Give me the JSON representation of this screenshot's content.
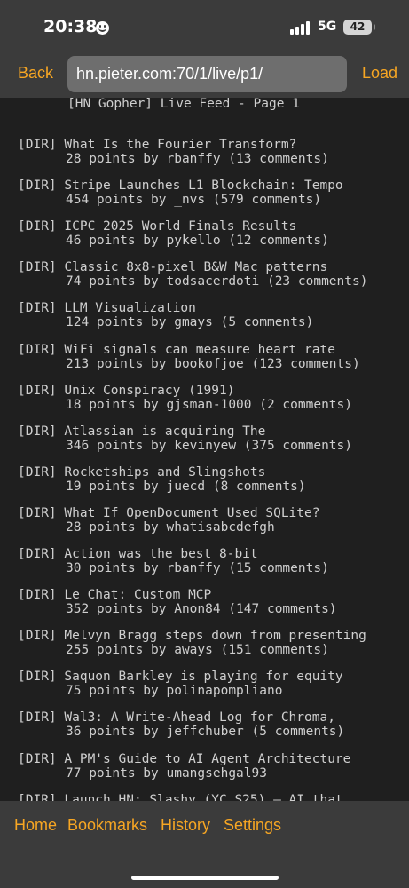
{
  "status": {
    "time": "20:38",
    "network": "5G",
    "battery": "42"
  },
  "nav": {
    "back_label": "Back",
    "url": "hn.pieter.com:70/1/live/p1/",
    "load_label": "Load"
  },
  "header": "[HN Gopher] Live Feed - Page 1",
  "entries": [
    {
      "type": "[DIR]",
      "title": "What Is the Fourier Transform?",
      "meta": "28 points by rbanffy (13 comments)"
    },
    {
      "type": "[DIR]",
      "title": "Stripe Launches L1 Blockchain: Tempo",
      "meta": "454 points by _nvs (579 comments)"
    },
    {
      "type": "[DIR]",
      "title": "ICPC 2025 World Finals Results",
      "meta": "46 points by pykello (12 comments)"
    },
    {
      "type": "[DIR]",
      "title": "Classic 8x8-pixel B&W Mac patterns",
      "meta": "74 points by todsacerdoti (23 comments)"
    },
    {
      "type": "[DIR]",
      "title": "LLM Visualization",
      "meta": "124 points by gmays (5 comments)"
    },
    {
      "type": "[DIR]",
      "title": "WiFi signals can measure heart rate",
      "meta": "213 points by bookofjoe (123 comments)"
    },
    {
      "type": "[DIR]",
      "title": "Unix Conspiracy (1991)",
      "meta": "18 points by gjsman-1000 (2 comments)"
    },
    {
      "type": "[DIR]",
      "title": "Atlassian is acquiring The",
      "meta": "346 points by kevinyew (375 comments)"
    },
    {
      "type": "[DIR]",
      "title": "Rocketships and Slingshots",
      "meta": "19 points by juecd (8 comments)"
    },
    {
      "type": "[DIR]",
      "title": "What If OpenDocument Used SQLite?",
      "meta": "28 points by whatisabcdefgh"
    },
    {
      "type": "[DIR]",
      "title": "Action was the best 8-bit",
      "meta": "30 points by rbanffy (15 comments)"
    },
    {
      "type": "[DIR]",
      "title": "Le Chat: Custom MCP",
      "meta": "352 points by Anon84 (147 comments)"
    },
    {
      "type": "[DIR]",
      "title": "Melvyn Bragg steps down from presenting",
      "meta": "255 points by aways (151 comments)"
    },
    {
      "type": "[DIR]",
      "title": "Saquon Barkley is playing for equity",
      "meta": "75 points by polinapompliano"
    },
    {
      "type": "[DIR]",
      "title": "Wal3: A Write-Ahead Log for Chroma,",
      "meta": "36 points by jeffchuber (5 comments)"
    },
    {
      "type": "[DIR]",
      "title": "A PM's Guide to AI Agent Architecture",
      "meta": "77 points by umangsehgal93"
    },
    {
      "type": "[DIR]",
      "title": "Launch HN: Slashy (YC S25) – AI that",
      "meta": ""
    }
  ],
  "tabs": {
    "home": "Home",
    "bookmarks": "Bookmarks",
    "history": "History",
    "settings": "Settings"
  },
  "colors": {
    "accent": "#f7a623",
    "bar": "#3b3b3b",
    "content_bg": "#1f1f1f",
    "text": "#cfcfcf"
  }
}
